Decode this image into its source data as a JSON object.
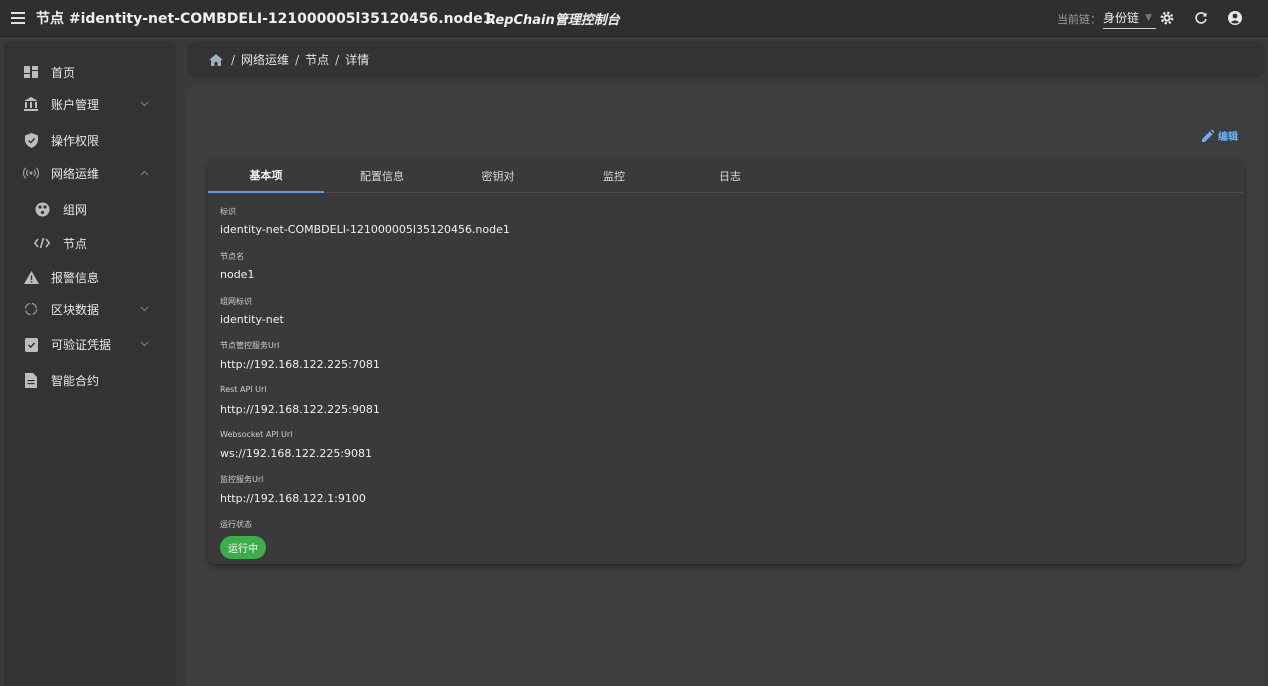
{
  "topbar": {
    "title": "节点 #identity-net-COMBDELI-121000005l35120456.node1",
    "brand": "RepChain管理控制台",
    "chain_label": "当前链：",
    "chain_value": "身份链"
  },
  "sidebar": {
    "items": [
      {
        "label": "首页",
        "icon": "dashboard-icon"
      },
      {
        "label": "账户管理",
        "icon": "bank-icon",
        "expandable": true
      },
      {
        "label": "操作权限",
        "icon": "shield-icon"
      },
      {
        "label": "网络运维",
        "icon": "signal-icon",
        "expanded": true
      },
      {
        "label": "组网",
        "icon": "network-icon",
        "sub": true
      },
      {
        "label": "节点",
        "icon": "code-icon",
        "sub": true,
        "active": true
      },
      {
        "label": "报警信息",
        "icon": "warning-icon"
      },
      {
        "label": "区块数据",
        "icon": "loading-icon",
        "expandable": true
      },
      {
        "label": "可验证凭据",
        "icon": "clipboard-check-icon",
        "expandable": true
      },
      {
        "label": "智能合约",
        "icon": "file-icon"
      }
    ]
  },
  "breadcrumb": {
    "items": [
      "网络运维",
      "节点",
      "详情"
    ]
  },
  "edit_label": "编辑",
  "tabs": [
    "基本项",
    "配置信息",
    "密钥对",
    "监控",
    "日志"
  ],
  "fields": [
    {
      "label": "标识",
      "value": "identity-net-COMBDELI-121000005l35120456.node1"
    },
    {
      "label": "节点名",
      "value": "node1"
    },
    {
      "label": "组网标识",
      "value": "identity-net"
    },
    {
      "label": "节点管控服务Url",
      "value": "http://192.168.122.225:7081"
    },
    {
      "label": "Rest API Url",
      "value": "http://192.168.122.225:9081"
    },
    {
      "label": "Websocket API Url",
      "value": "ws://192.168.122.225:9081"
    },
    {
      "label": "监控服务Url",
      "value": "http://192.168.122.1:9100"
    }
  ],
  "status": {
    "label": "运行状态",
    "value": "运行中",
    "color": "#3cae49"
  },
  "colors": {
    "accent": "#5aa0e6",
    "link": "#6ab4f5",
    "success": "#3cae49"
  }
}
